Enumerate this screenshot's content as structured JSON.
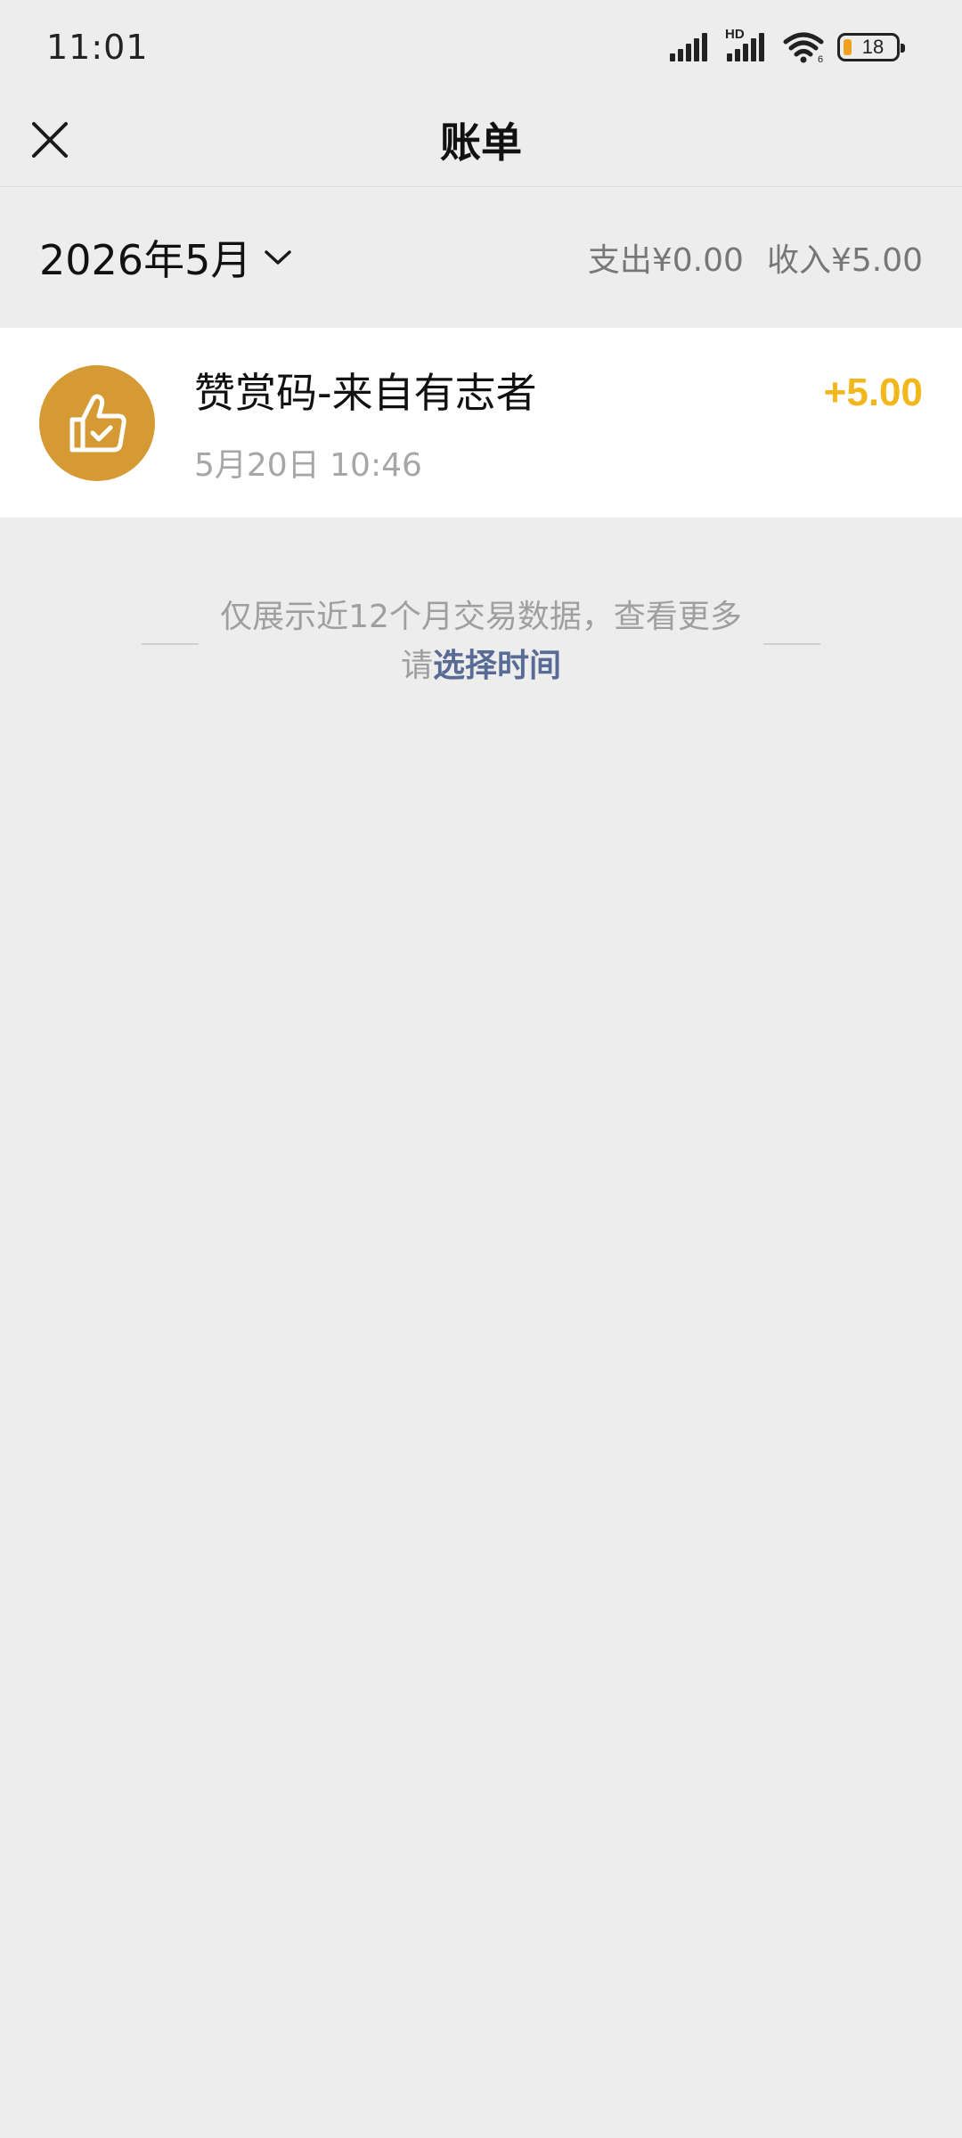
{
  "status_bar": {
    "time": "11:01",
    "network_badge": "HD",
    "battery_level": "18",
    "icons": [
      "signal-icon",
      "hd-signal-icon",
      "wifi-icon",
      "battery-icon"
    ]
  },
  "nav": {
    "title": "账单",
    "close_icon": "close-icon"
  },
  "month_header": {
    "month_label": "2026年5月",
    "expense_label": "支出¥0.00",
    "income_label": "收入¥5.00"
  },
  "transactions": [
    {
      "title": "赞赏码-来自有志者",
      "time": "5月20日 10:46",
      "amount": "+5.00",
      "icon": "thumbs-up-check-icon",
      "icon_color": "#d69a34",
      "amount_color": "#f2b71c"
    }
  ],
  "footer_note": {
    "line1": "仅展示近12个月交易数据，查看更多",
    "prefix": "请",
    "link": "选择时间"
  },
  "colors": {
    "background": "#ededed",
    "link": "#576b95"
  }
}
